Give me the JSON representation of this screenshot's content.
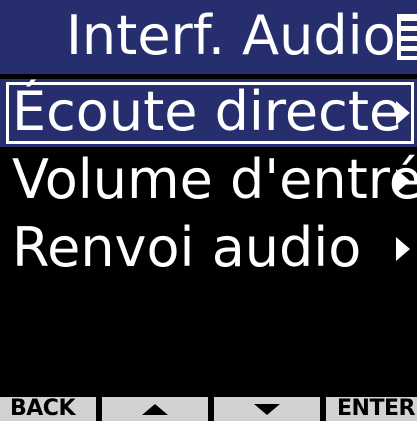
{
  "header": {
    "title": "Interf. Audio",
    "battery_icon": "battery-icon"
  },
  "menu": {
    "items": [
      {
        "label": "Écoute directe",
        "selected": true,
        "icon": "chevron-right-icon"
      },
      {
        "label": "Volume d'entré",
        "selected": false,
        "icon": "chevron-right-icon"
      },
      {
        "label": "Renvoi audio",
        "selected": false,
        "icon": "chevron-right-icon"
      }
    ]
  },
  "softkeys": {
    "back": "BACK",
    "up_icon": "triangle-up-icon",
    "down_icon": "triangle-down-icon",
    "enter": "ENTER"
  },
  "colors": {
    "accent": "#272e6e",
    "background": "#000000",
    "softkey_bg": "#d2d2d2",
    "text": "#ffffff"
  }
}
